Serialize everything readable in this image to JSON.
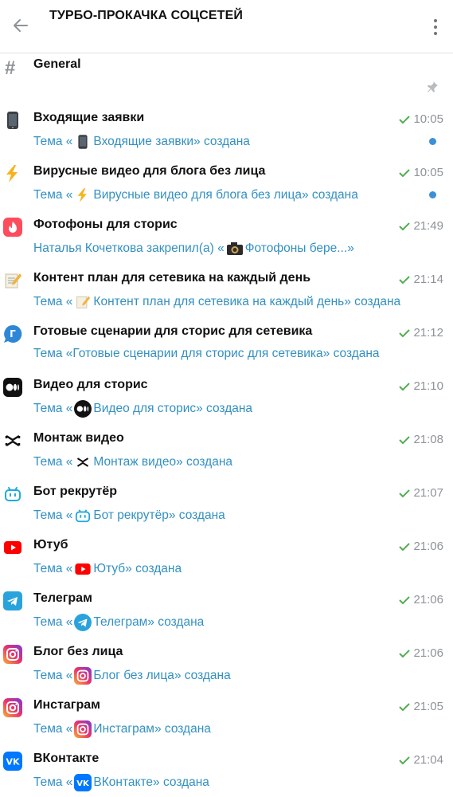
{
  "header": {
    "title": "ТУРБО-ПРОКАЧКА СОЦСЕТЕЙ"
  },
  "general": {
    "name": "General"
  },
  "topics": [
    {
      "name": "Входящие заявки",
      "time": "10:05",
      "pre": "Тема «",
      "mid": "Входящие заявки",
      "post": "» создана",
      "unread": true
    },
    {
      "name": "Вирусные видео для блога без лица",
      "time": "10:05",
      "pre": "Тема «",
      "mid": "Вирусные видео для блога без лица",
      "post": "» создана",
      "unread": true
    },
    {
      "name": "Фотофоны для сторис",
      "time": "21:49",
      "pre": "Наталья Кочеткова закрепил(а) «",
      "mid": "Фотофоны бере...»",
      "post": ""
    },
    {
      "name": "Контент план для сетевика на каждый день",
      "time": "21:14",
      "pre": "Тема «",
      "mid": "Контент план для сетевика на каждый день",
      "post": "» создана"
    },
    {
      "name": "Готовые сценарии для сторис для сетевика",
      "time": "21:12",
      "pre": "Тема «Готовые сценарии для сторис для сетевика» создана",
      "mid": "",
      "post": ""
    },
    {
      "name": "Видео для сторис",
      "time": "21:10",
      "pre": "Тема «",
      "mid": "Видео для сторис",
      "post": "» создана"
    },
    {
      "name": "Монтаж видео",
      "time": "21:08",
      "pre": "Тема «",
      "mid": "Монтаж видео",
      "post": "» создана"
    },
    {
      "name": "Бот рекрутёр",
      "time": "21:07",
      "pre": "Тема «",
      "mid": "Бот рекрутёр",
      "post": "» создана"
    },
    {
      "name": "Ютуб",
      "time": "21:06",
      "pre": "Тема «",
      "mid": "Ютуб",
      "post": "» создана"
    },
    {
      "name": "Телеграм",
      "time": "21:06",
      "pre": "Тема «",
      "mid": "Телеграм",
      "post": "» создана"
    },
    {
      "name": "Блог без лица",
      "time": "21:06",
      "pre": "Тема «",
      "mid": "Блог без лица",
      "post": "» создана"
    },
    {
      "name": "Инстаграм",
      "time": "21:05",
      "pre": "Тема «",
      "mid": "Инстаграм",
      "post": "» создана"
    },
    {
      "name": "ВКонтакте",
      "time": "21:04",
      "pre": "Тема «",
      "mid": "ВКонтакте",
      "post": "» создана"
    }
  ],
  "colors": {
    "accent": "#3390c1",
    "check": "#4fae4e",
    "unread_dot": "#3d8fd9"
  },
  "icons": [
    "back-arrow-icon",
    "more-vertical-icon",
    "hash-icon",
    "pin-icon",
    "phone-icon",
    "lightning-icon",
    "tinder-flame-icon",
    "memo-icon",
    "g-bubble-icon",
    "medium-icon",
    "capcut-icon",
    "bot-icon",
    "youtube-icon",
    "telegram-icon",
    "instagram-icon",
    "vk-icon",
    "camera-icon",
    "check-icon"
  ]
}
